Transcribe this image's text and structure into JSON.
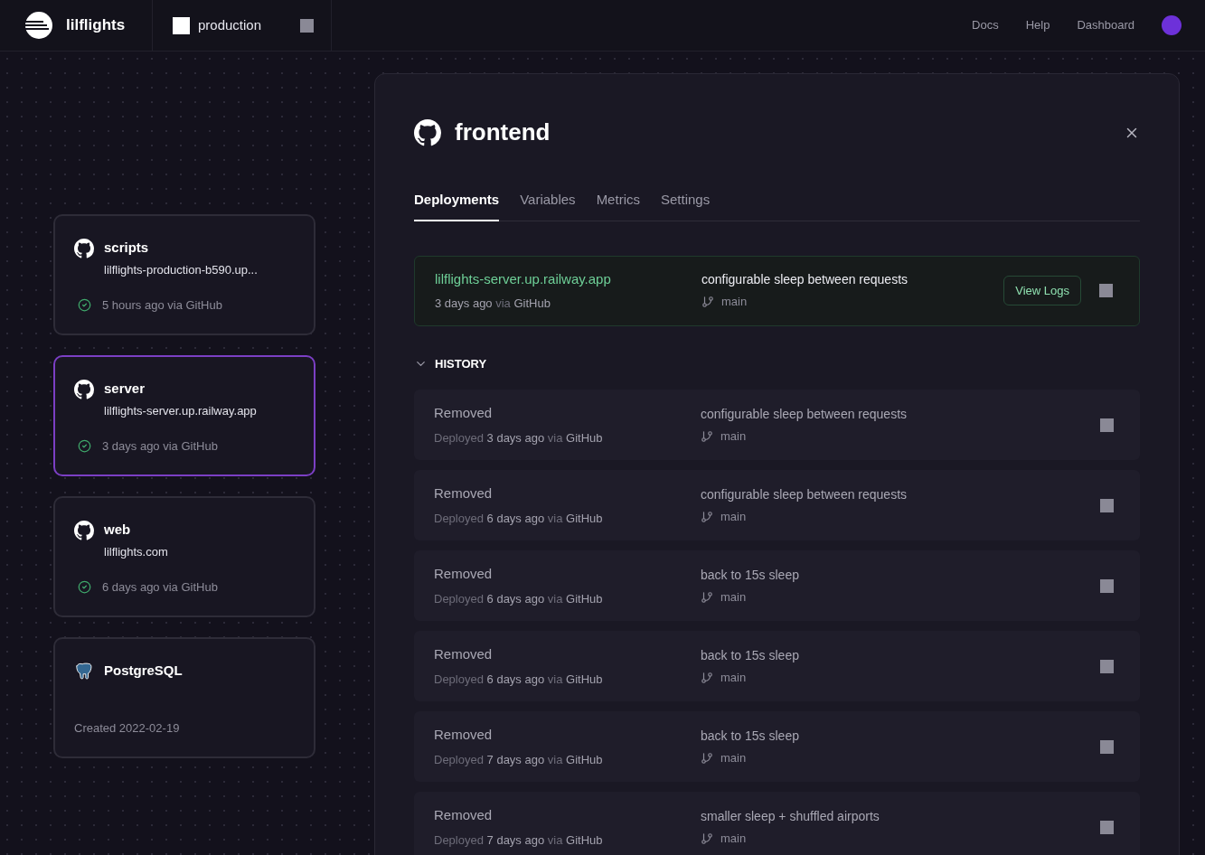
{
  "header": {
    "brand": "lilflights",
    "environment": "production",
    "links": [
      "Docs",
      "Help",
      "Dashboard"
    ]
  },
  "services": [
    {
      "kind": "github",
      "name": "scripts",
      "url": "lilflights-production-b590.up...",
      "status": "5 hours ago via GitHub",
      "selected": false
    },
    {
      "kind": "github",
      "name": "server",
      "url": "lilflights-server.up.railway.app",
      "status": "3 days ago via GitHub",
      "selected": true
    },
    {
      "kind": "github",
      "name": "web",
      "url": "lilflights.com",
      "status": "6 days ago via GitHub",
      "selected": false
    },
    {
      "kind": "postgres",
      "name": "PostgreSQL",
      "status": "Created 2022-02-19",
      "selected": false
    }
  ],
  "panel": {
    "title": "frontend",
    "tabs": [
      {
        "label": "Deployments",
        "selected": true
      },
      {
        "label": "Variables",
        "selected": false
      },
      {
        "label": "Metrics",
        "selected": false
      },
      {
        "label": "Settings",
        "selected": false
      }
    ],
    "active_deployment": {
      "url": "lilflights-server.up.railway.app",
      "time": "3 days ago",
      "via": "via",
      "source": "GitHub",
      "message": "configurable sleep between requests",
      "branch": "main",
      "button": "View Logs"
    },
    "history": {
      "label": "HISTORY",
      "expanded": true,
      "rows": [
        {
          "status": "Removed",
          "deployed": "Deployed",
          "time": "3 days ago",
          "via": "via",
          "source": "GitHub",
          "message": "configurable sleep between requests",
          "branch": "main"
        },
        {
          "status": "Removed",
          "deployed": "Deployed",
          "time": "6 days ago",
          "via": "via",
          "source": "GitHub",
          "message": "configurable sleep between requests",
          "branch": "main"
        },
        {
          "status": "Removed",
          "deployed": "Deployed",
          "time": "6 days ago",
          "via": "via",
          "source": "GitHub",
          "message": "back to 15s sleep",
          "branch": "main"
        },
        {
          "status": "Removed",
          "deployed": "Deployed",
          "time": "6 days ago",
          "via": "via",
          "source": "GitHub",
          "message": "back to 15s sleep",
          "branch": "main"
        },
        {
          "status": "Removed",
          "deployed": "Deployed",
          "time": "7 days ago",
          "via": "via",
          "source": "GitHub",
          "message": "back to 15s sleep",
          "branch": "main"
        },
        {
          "status": "Removed",
          "deployed": "Deployed",
          "time": "7 days ago",
          "via": "via",
          "source": "GitHub",
          "message": "smaller sleep + shuffled airports",
          "branch": "main"
        }
      ]
    }
  }
}
